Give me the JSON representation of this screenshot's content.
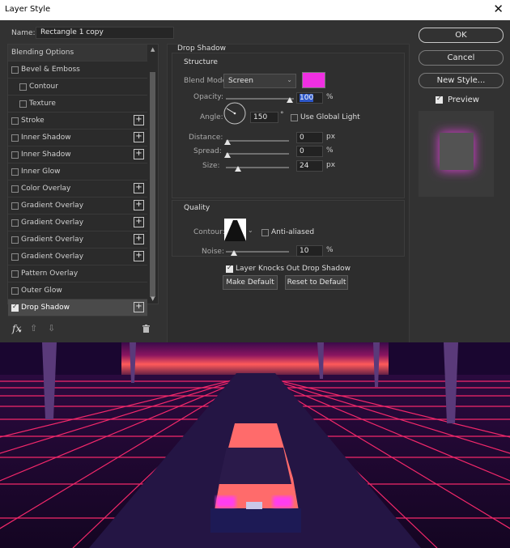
{
  "window": {
    "title": "Layer Style"
  },
  "name_field": {
    "label": "Name:",
    "value": "Rectangle 1 copy"
  },
  "styles": [
    {
      "label": "Blending Options",
      "checkbox": false,
      "plus": false,
      "indent": 0,
      "checked": false
    },
    {
      "label": "Bevel & Emboss",
      "checkbox": true,
      "plus": false,
      "indent": 0,
      "checked": false
    },
    {
      "label": "Contour",
      "checkbox": true,
      "plus": false,
      "indent": 1,
      "checked": false
    },
    {
      "label": "Texture",
      "checkbox": true,
      "plus": false,
      "indent": 1,
      "checked": false
    },
    {
      "label": "Stroke",
      "checkbox": true,
      "plus": true,
      "indent": 0,
      "checked": false
    },
    {
      "label": "Inner Shadow",
      "checkbox": true,
      "plus": true,
      "indent": 0,
      "checked": false
    },
    {
      "label": "Inner Shadow",
      "checkbox": true,
      "plus": true,
      "indent": 0,
      "checked": false
    },
    {
      "label": "Inner Glow",
      "checkbox": true,
      "plus": false,
      "indent": 0,
      "checked": false
    },
    {
      "label": "Color Overlay",
      "checkbox": true,
      "plus": true,
      "indent": 0,
      "checked": false
    },
    {
      "label": "Gradient Overlay",
      "checkbox": true,
      "plus": true,
      "indent": 0,
      "checked": false
    },
    {
      "label": "Gradient Overlay",
      "checkbox": true,
      "plus": true,
      "indent": 0,
      "checked": false
    },
    {
      "label": "Gradient Overlay",
      "checkbox": true,
      "plus": true,
      "indent": 0,
      "checked": false
    },
    {
      "label": "Gradient Overlay",
      "checkbox": true,
      "plus": true,
      "indent": 0,
      "checked": false
    },
    {
      "label": "Pattern Overlay",
      "checkbox": true,
      "plus": false,
      "indent": 0,
      "checked": false
    },
    {
      "label": "Outer Glow",
      "checkbox": true,
      "plus": false,
      "indent": 0,
      "checked": false
    },
    {
      "label": "Drop Shadow",
      "checkbox": true,
      "plus": true,
      "indent": 0,
      "checked": true,
      "selected": true
    }
  ],
  "bottom_toolbar": {
    "fx_label": "fx"
  },
  "drop_shadow": {
    "section_title": "Drop Shadow",
    "structure_title": "Structure",
    "blend_mode_label": "Blend Mode:",
    "blend_mode_value": "Screen",
    "shadow_color": "#f02fe2",
    "opacity_label": "Opacity:",
    "opacity_value": "100",
    "opacity_unit": "%",
    "angle_label": "Angle:",
    "angle_value": "150",
    "angle_unit": "°",
    "use_global_light_label": "Use Global Light",
    "distance_label": "Distance:",
    "distance_value": "0",
    "distance_unit": "px",
    "spread_label": "Spread:",
    "spread_value": "0",
    "spread_unit": "%",
    "size_label": "Size:",
    "size_value": "24",
    "size_unit": "px",
    "quality_title": "Quality",
    "contour_label": "Contour:",
    "anti_aliased_label": "Anti-aliased",
    "noise_label": "Noise:",
    "noise_value": "10",
    "noise_unit": "%",
    "knockout_label": "Layer Knocks Out Drop Shadow",
    "make_default_label": "Make Default",
    "reset_default_label": "Reset to Default"
  },
  "buttons": {
    "ok": "OK",
    "cancel": "Cancel",
    "new_style": "New Style..."
  },
  "preview": {
    "label": "Preview",
    "checked": true
  },
  "colors": {
    "dialog_bg": "#323232",
    "glow": "#e83fe0",
    "grid": "#ff2a6e",
    "sky_top": "#ff5a5a"
  }
}
